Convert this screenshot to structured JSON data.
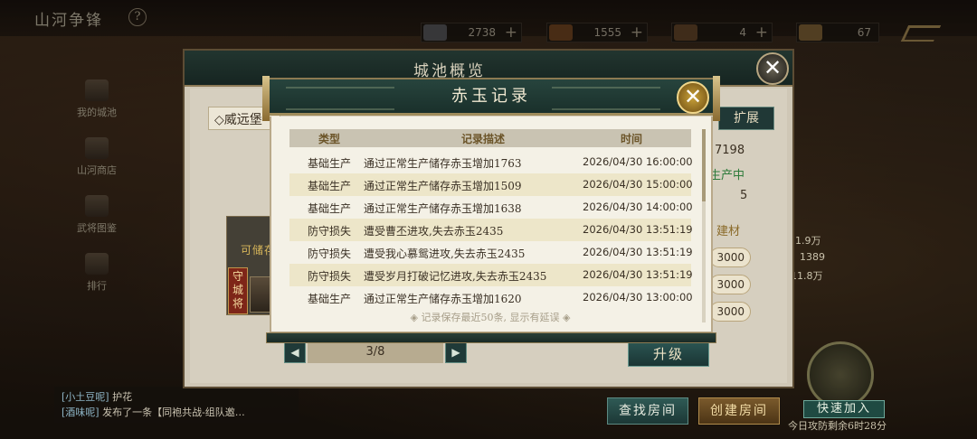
{
  "top_bar": {
    "title": "山河争锋",
    "help": "?",
    "resources": [
      {
        "icon": "tile-icon",
        "value": "2738",
        "color": "#6b6d72"
      },
      {
        "icon": "jade-icon",
        "value": "1555",
        "color": "#7a4a22"
      },
      {
        "icon": "wood-icon",
        "value": "4",
        "color": "#6a4a2a"
      },
      {
        "icon": "soldier-icon",
        "value": "67",
        "color": "#8a6a3a"
      }
    ]
  },
  "left_menu": [
    {
      "label": "我的城池"
    },
    {
      "label": "山河商店"
    },
    {
      "label": "武将图鉴"
    },
    {
      "label": "排行"
    }
  ],
  "chat": {
    "line1_tag": "[小土豆呢]",
    "line1_text": "护花",
    "line2_tag": "[酒味呢]",
    "line2_text": "发布了一条【同袍共战-组队邀…"
  },
  "outer_panel": {
    "title": "城池概览",
    "close": "✕",
    "city_tab": "◇威远堡",
    "expand": "扩展",
    "info_value": "7198",
    "status": "生产中",
    "level": "5",
    "build_label": "建材",
    "pills": [
      "3000",
      "3000",
      "3000"
    ],
    "storable": "可储存",
    "guard": "守城将",
    "pager_prev": "◀",
    "pager_text": "3/8",
    "pager_next": "▶",
    "upgrade": "升级",
    "side_values": [
      "11.9万",
      "1389",
      "11.8万"
    ]
  },
  "modal": {
    "title": "赤玉记录",
    "close": "✕",
    "columns": {
      "type": "类型",
      "desc": "记录描述",
      "time": "时间"
    },
    "rows": [
      {
        "type": "基础生产",
        "desc": "通过正常生产储存赤玉增加1763",
        "time": "2026/04/30 16:00:00"
      },
      {
        "type": "基础生产",
        "desc": "通过正常生产储存赤玉增加1509",
        "time": "2026/04/30 15:00:00"
      },
      {
        "type": "基础生产",
        "desc": "通过正常生产储存赤玉增加1638",
        "time": "2026/04/30 14:00:00"
      },
      {
        "type": "防守损失",
        "desc": "遭受曹丕进攻,失去赤玉2435",
        "time": "2026/04/30 13:51:19"
      },
      {
        "type": "防守损失",
        "desc": "遭受我心慕鸳进攻,失去赤玉2435",
        "time": "2026/04/30 13:51:19"
      },
      {
        "type": "防守损失",
        "desc": "遭受岁月打破记忆进攻,失去赤玉2435",
        "time": "2026/04/30 13:51:19"
      },
      {
        "type": "基础生产",
        "desc": "通过正常生产储存赤玉增加1620",
        "time": "2026/04/30 13:00:00"
      }
    ],
    "note": "◈ 记录保存最近50条, 显示有延误 ◈"
  },
  "bottom": {
    "find_room": "查找房间",
    "create_room": "创建房间",
    "quick_join": "快速加入",
    "defense_note": "今日攻防剩余6时28分"
  }
}
